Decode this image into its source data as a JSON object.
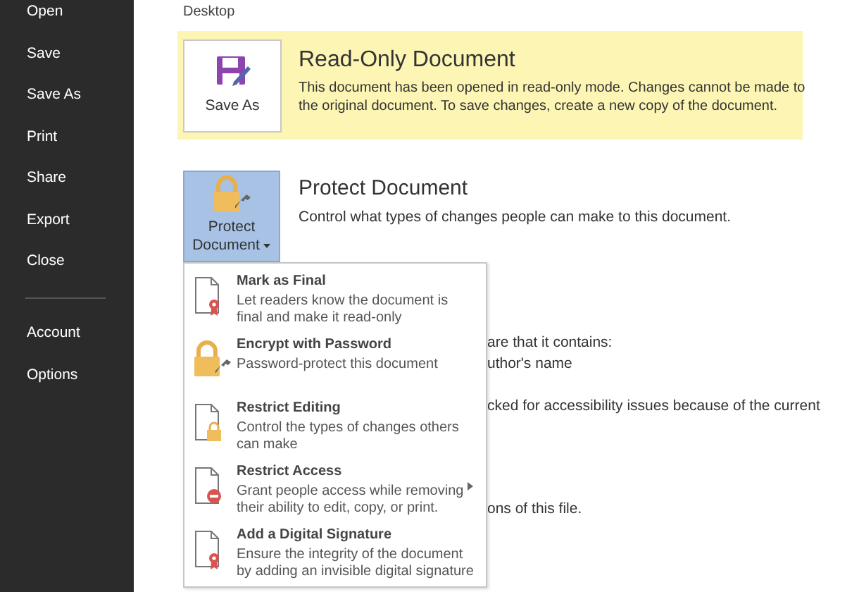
{
  "sidebar": {
    "items": [
      "Open",
      "Save",
      "Save As",
      "Print",
      "Share",
      "Export",
      "Close"
    ],
    "lower_items": [
      "Account",
      "Options"
    ]
  },
  "location": "Desktop",
  "read_only_banner": {
    "button": "Save As",
    "title": "Read-Only Document",
    "text": "This document has been opened in read-only mode. Changes cannot be made to the original document. To save changes, create a new copy of the document."
  },
  "protect_section": {
    "button_line_1": "Protect",
    "button_line_2": "Document",
    "title": "Protect Document",
    "text": "Control what types of changes people can make to this document.",
    "expanded": true
  },
  "hidden_text": [
    "are that it contains:",
    "uthor's name",
    "cked for accessibility issues because of the current",
    "ons of this file."
  ],
  "protect_menu": [
    {
      "kind": "final",
      "title": "Mark as Final",
      "text": "Let readers know the document is final and make it read-only",
      "submenu": false
    },
    {
      "kind": "password",
      "title": "Encrypt with Password",
      "text": "Password-protect this document",
      "submenu": false
    },
    {
      "kind": "editing",
      "title": "Restrict Editing",
      "text": "Control the types of changes others can make",
      "submenu": false
    },
    {
      "kind": "access",
      "title": "Restrict Access",
      "text": "Grant people access while removing their ability to edit, copy, or print.",
      "submenu": true
    },
    {
      "kind": "signature",
      "title": "Add a Digital Signature",
      "text": "Ensure the integrity of the document by adding an invisible digital signature",
      "submenu": false
    }
  ]
}
